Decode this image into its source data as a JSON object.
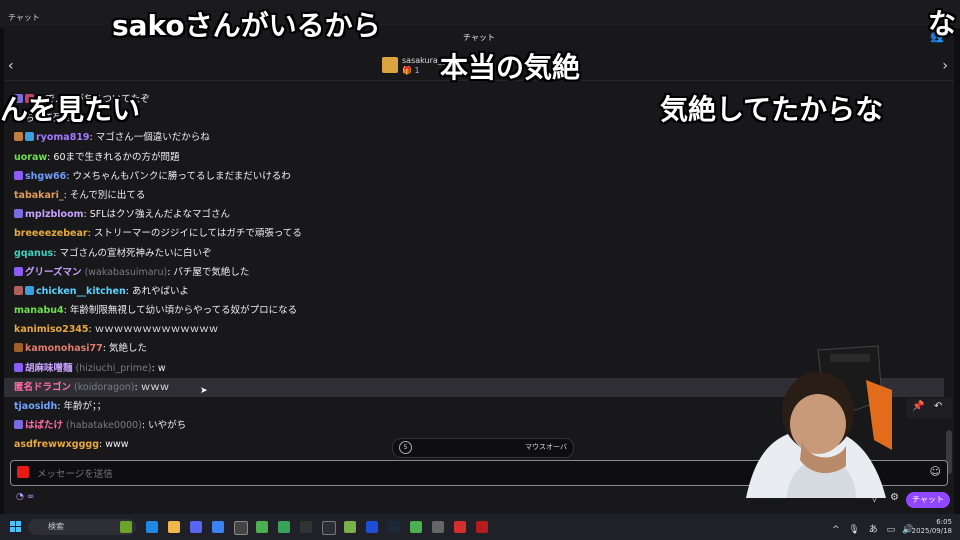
{
  "window": {
    "title": "チャット"
  },
  "chat": {
    "header_title": "チャット",
    "gift_banner": {
      "user": "sasakura_g...",
      "count": "1"
    },
    "messages": [
      {
        "user": "",
        "alt": "",
        "text": "…で…限がちらついてたぞ",
        "color": "#ff4f4f",
        "badges": [
          "#7b6be0",
          "#c2446e"
        ]
      },
      {
        "user": "",
        "alt": "",
        "text": "ちって死ね",
        "color": "#d9a441",
        "badges": [
          "#555555"
        ]
      },
      {
        "user": "ryoma819",
        "alt": "",
        "text": "マゴさん一個違いだからね",
        "color": "#a47aff",
        "badges": [
          "#c08040",
          "#3aa0e0"
        ]
      },
      {
        "user": "uoraw",
        "alt": "",
        "text": "60まで生きれるかの方が問題",
        "color": "#6ce04a",
        "badges": []
      },
      {
        "user": "shgw66",
        "alt": "",
        "text": "ウメちゃんもパンクに勝ってるしまだまだいけるわ",
        "color": "#6f9cff",
        "badges": [
          "#8b5cf6"
        ]
      },
      {
        "user": "tabakari_",
        "alt": "",
        "text": "そんで別に出てる",
        "color": "#e09a5a",
        "badges": []
      },
      {
        "user": "mplzbloom",
        "alt": "",
        "text": "SFLはクソ強えんだよなマゴさん",
        "color": "#c8a2ff",
        "badges": [
          "#7b6be0"
        ]
      },
      {
        "user": "breeeezebear",
        "alt": "",
        "text": "ストリーマーのジジイにしてはガチで頑張ってる",
        "color": "#e6a93a",
        "badges": []
      },
      {
        "user": "gqanus",
        "alt": "",
        "text": "マゴさんの宣材死神みたいに白いぞ",
        "color": "#3ad1c1",
        "badges": []
      },
      {
        "user": "グリーズマン",
        "alt": "(wakabasuimaru)",
        "text": "パチ屋で気絶した",
        "color": "#c8a2ff",
        "badges": [
          "#8b5cf6"
        ]
      },
      {
        "user": "chicken__kitchen",
        "alt": "",
        "text": "あれやばいよ",
        "color": "#57d3ff",
        "badges": [
          "#b0605a",
          "#3aa0e0"
        ]
      },
      {
        "user": "manabu4",
        "alt": "",
        "text": "年齢制限無視して幼い頃からやってる奴がプロになる",
        "color": "#6ce04a",
        "badges": []
      },
      {
        "user": "kanimiso2345",
        "alt": "",
        "text": "ｗｗｗｗｗｗｗｗｗｗｗｗｗ",
        "color": "#e6a93a",
        "badges": []
      },
      {
        "user": "kamonohasi77",
        "alt": "",
        "text": "気絶した",
        "color": "#e07a6a",
        "badges": [
          "#a0602a"
        ]
      },
      {
        "user": "胡麻味噌麺",
        "alt": "(hiziuchi_prime)",
        "text": "w",
        "color": "#c8a2ff",
        "badges": [
          "#8b5cf6"
        ]
      },
      {
        "user": "匿名ドラゴン",
        "alt": "(koidoragon)",
        "text": "ｗｗｗ",
        "color": "#ff6fa5",
        "badges": [],
        "highlight": true
      },
      {
        "user": "tjaosidh",
        "alt": "",
        "text": "年齢が；；",
        "color": "#6fa3ff",
        "badges": []
      },
      {
        "user": "はばたけ",
        "alt": "(habatake0000)",
        "text": "いやがち",
        "color": "#ff6fa5",
        "badges": [
          "#7b6be0"
        ]
      },
      {
        "user": "asdfrewwxgggg",
        "alt": "",
        "text": "www",
        "color": "#e6a93a",
        "badges": []
      }
    ],
    "timer_pill": {
      "label": "マウスオーバ"
    },
    "input": {
      "placeholder": "メッセージを送信",
      "value": ""
    },
    "points": "∞",
    "send_button": "チャット"
  },
  "captions": [
    {
      "text": "sakoさんがいるから"
    },
    {
      "text": "本当の気絶"
    },
    {
      "text": "んを見たい"
    },
    {
      "text": "気絶してたからな"
    },
    {
      "text": "な"
    }
  ],
  "taskbar": {
    "search_placeholder": "検索",
    "time": "6:05",
    "date": "2025/09/18",
    "ime": "あ"
  },
  "colors": {
    "accent": "#9147ff",
    "panel": "#18181b",
    "background": "#0e0e10"
  }
}
